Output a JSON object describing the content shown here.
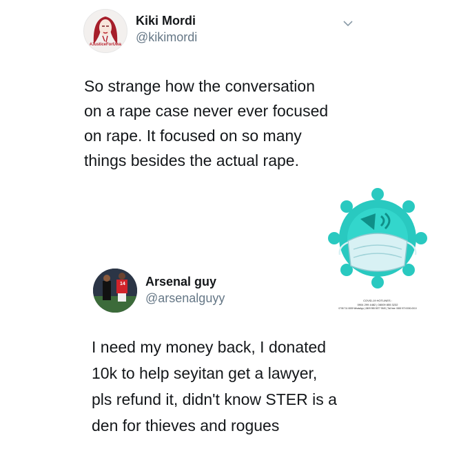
{
  "tweet1": {
    "name": "Kiki Mordi",
    "handle": "@kikimordi",
    "avatar_caption": "#JusticeForUwa",
    "lines": [
      "So strange how the conversation",
      "on a rape case never ever focused",
      "on rape. It focused on so many",
      "things besides the actual rape."
    ],
    "menu_icon": "chevron-down-icon"
  },
  "badge": {
    "icon": "virus-mask-sticker",
    "title": "COVID-19 HOTLINES :",
    "line1": "0904 299 4482 | 08009 855 3232",
    "line2": "0708 711 0839 WhatsApp | 0809 955 5577 SMS | Toll free: 0800 970 0000-0010"
  },
  "tweet2": {
    "name": "Arsenal guy",
    "handle": "@arsenalguyy",
    "jersey_number": "14",
    "lines": [
      "I need my money back, I donated",
      "10k to help seyitan get a lawyer,",
      "pls refund it, didn't know STER is a",
      "den for thieves and rogues"
    ]
  },
  "colors": {
    "name": "#14171a",
    "handle": "#657786",
    "virus": "#29c9c0",
    "virus_dark": "#0f8f88",
    "mask": "#d8f1f4",
    "avatar_red": "#b7212c"
  }
}
